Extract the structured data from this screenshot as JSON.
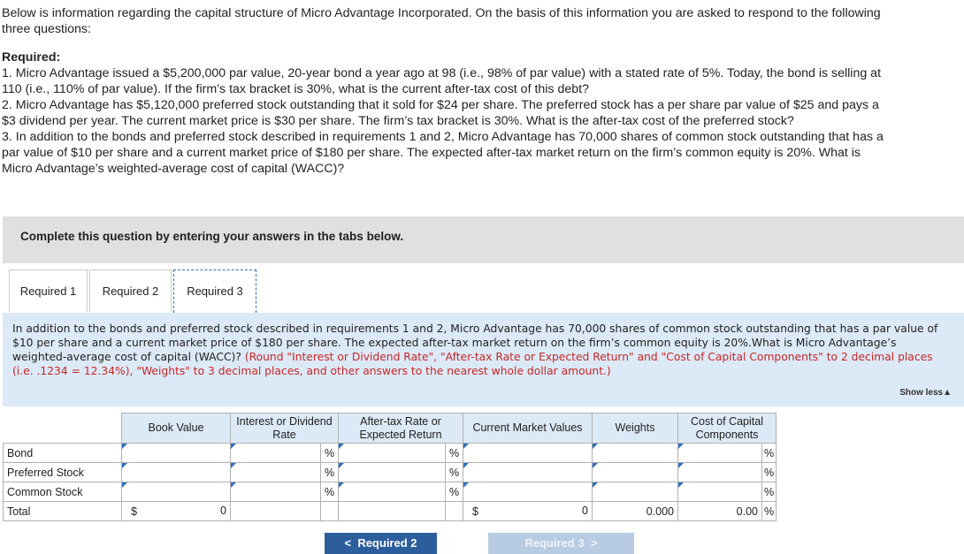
{
  "intro": {
    "line1": "Below is information regarding the capital structure of Micro Advantage Incorporated. On the basis of this information you are asked to respond to the following three questions:",
    "required_heading": "Required:",
    "q1": "1. Micro Advantage issued a $5,200,000 par value, 20-year bond a year ago at 98 (i.e., 98% of par value) with a stated rate of 5%. Today, the bond is selling at 110 (i.e., 110% of par value). If the firm’s tax bracket is 30%, what is the current after-tax cost of this debt?",
    "q2": "2. Micro Advantage has $5,120,000 preferred stock outstanding that it sold for $24 per share. The preferred stock has a per share par value of $25 and pays a $3 dividend per year. The current market price is $30 per share. The firm’s tax bracket is 30%. What is the after-tax cost of the preferred stock?",
    "q3": "3. In addition to the bonds and preferred stock described in requirements 1 and 2, Micro Advantage has 70,000 shares of common stock outstanding that has a par value of $10 per share and a current market price of $180 per share. The expected after-tax market return on the firm’s common equity is 20%. What is Micro Advantage’s weighted-average cost of capital (WACC)?"
  },
  "banner": "Complete this question by entering your answers in the tabs below.",
  "tabs": [
    "Required 1",
    "Required 2",
    "Required 3"
  ],
  "panel": {
    "text": "In addition to the bonds and preferred stock described in requirements 1 and 2, Micro Advantage has 70,000 shares of common stock outstanding that has a par value of $10 per share and a current market price of $180 per share. The expected after-tax market return on the firm’s common equity is 20%.What is Micro Advantage’s weighted-average cost of capital (WACC)? ",
    "instruction": "(Round \"Interest or Dividend Rate\", \"After-tax Rate or Expected Return\" and \"Cost of Capital Components\" to 2 decimal places (i.e. .1234 = 12.34%), \"Weights\" to 3 decimal places, and other answers to the nearest whole dollar amount.)",
    "show_less": "Show less"
  },
  "table": {
    "headers": [
      "Book Value",
      "Interest or Dividend Rate",
      "After-tax Rate or Expected Return",
      "Current Market Values",
      "Weights",
      "Cost of Capital Components"
    ],
    "rows": [
      "Bond",
      "Preferred Stock",
      "Common Stock"
    ],
    "total_label": "Total",
    "pct": "%",
    "dollar": "$",
    "total_book": "0",
    "total_market": "0",
    "total_weights": "0.000",
    "total_cost": "0.00"
  },
  "nav": {
    "prev": "Required 2",
    "next": "Required 3"
  }
}
